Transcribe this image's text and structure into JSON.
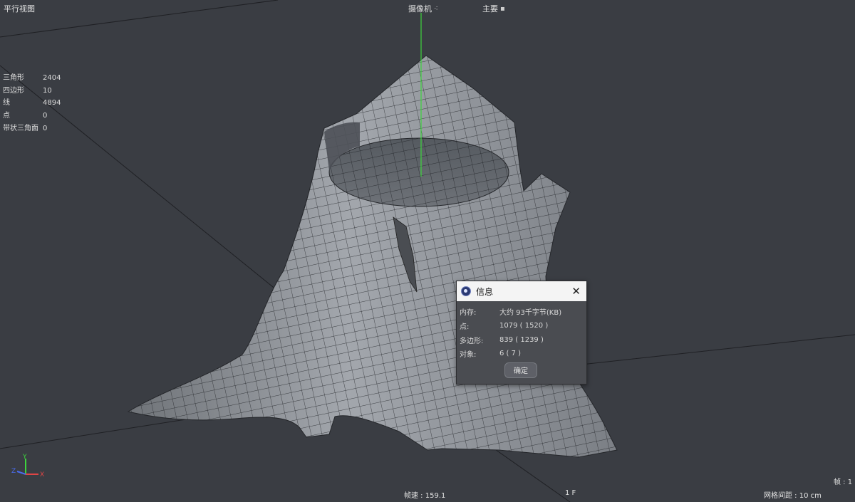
{
  "viewport": {
    "view_name": "平行视图",
    "camera_menu": "摄像机",
    "display_menu": "主要"
  },
  "stats": [
    {
      "label": "三角形",
      "value": "2404"
    },
    {
      "label": "四边形",
      "value": "10"
    },
    {
      "label": "线",
      "value": "4894"
    },
    {
      "label": "点",
      "value": "0"
    },
    {
      "label": "带状三角面",
      "value": "0"
    }
  ],
  "axes": {
    "x": "X",
    "y": "Y",
    "z": "Z"
  },
  "status": {
    "fps": "帧速 : 159.1",
    "frame": "1 F",
    "grid_spacing": "网格间距 : 10 cm",
    "frame_counter": "帧 : 1"
  },
  "dialog": {
    "title": "信息",
    "rows": [
      {
        "label": "内存:",
        "value": "大约 93千字节(KB)"
      },
      {
        "label": "点:",
        "value": "1079 ( 1520 )"
      },
      {
        "label": "多边形:",
        "value": "839 ( 1239 )"
      },
      {
        "label": "对象:",
        "value": "6 ( 7 )"
      }
    ],
    "ok_label": "确定"
  },
  "colors": {
    "background": "#3a3d43",
    "mesh": "#8c9096",
    "wire": "#1e2024",
    "y_axis": "#3dd53d",
    "x_axis": "#e04545",
    "z_axis": "#4a6cf0"
  }
}
